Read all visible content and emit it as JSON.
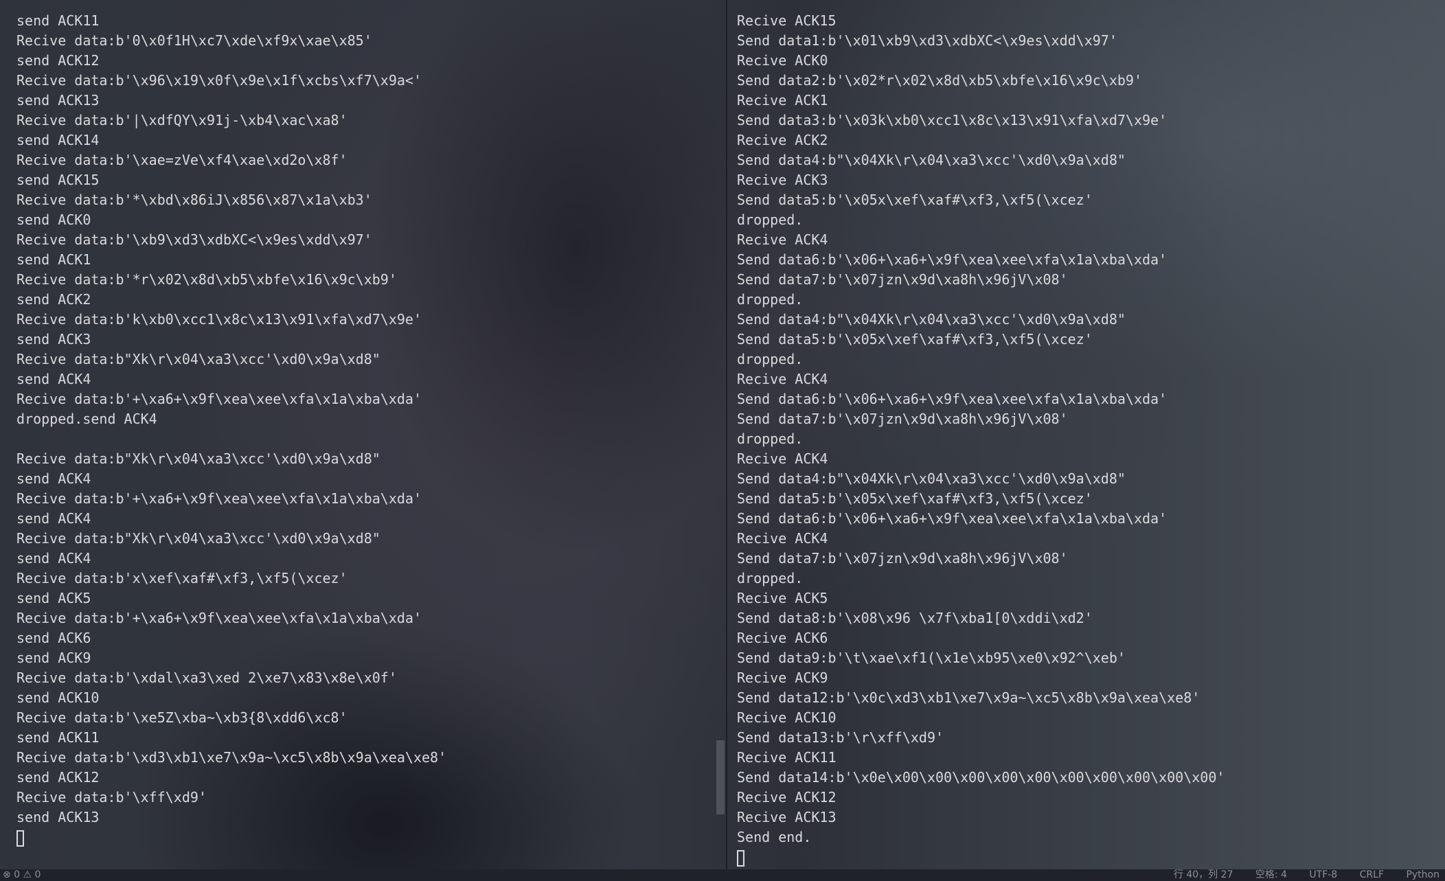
{
  "terminal_left": {
    "lines": [
      "send ACK11",
      "Recive data:b'0\\x0f1H\\xc7\\xde\\xf9x\\xae\\x85'",
      "send ACK12",
      "Recive data:b'\\x96\\x19\\x0f\\x9e\\x1f\\xcbs\\xf7\\x9a<'",
      "send ACK13",
      "Recive data:b'|\\xdfQY\\x91j-\\xb4\\xac\\xa8'",
      "send ACK14",
      "Recive data:b'\\xae=zVe\\xf4\\xae\\xd2o\\x8f'",
      "send ACK15",
      "Recive data:b'*\\xbd\\x86iJ\\x856\\x87\\x1a\\xb3'",
      "send ACK0",
      "Recive data:b'\\xb9\\xd3\\xdbXC<\\x9es\\xdd\\x97'",
      "send ACK1",
      "Recive data:b'*r\\x02\\x8d\\xb5\\xbfe\\x16\\x9c\\xb9'",
      "send ACK2",
      "Recive data:b'k\\xb0\\xcc1\\x8c\\x13\\x91\\xfa\\xd7\\x9e'",
      "send ACK3",
      "Recive data:b\"Xk\\r\\x04\\xa3\\xcc'\\xd0\\x9a\\xd8\"",
      "send ACK4",
      "Recive data:b'+\\xa6+\\x9f\\xea\\xee\\xfa\\x1a\\xba\\xda'",
      "dropped.send ACK4",
      "",
      "Recive data:b\"Xk\\r\\x04\\xa3\\xcc'\\xd0\\x9a\\xd8\"",
      "send ACK4",
      "Recive data:b'+\\xa6+\\x9f\\xea\\xee\\xfa\\x1a\\xba\\xda'",
      "send ACK4",
      "Recive data:b\"Xk\\r\\x04\\xa3\\xcc'\\xd0\\x9a\\xd8\"",
      "send ACK4",
      "Recive data:b'x\\xef\\xaf#\\xf3,\\xf5(\\xcez'",
      "send ACK5",
      "Recive data:b'+\\xa6+\\x9f\\xea\\xee\\xfa\\x1a\\xba\\xda'",
      "send ACK6",
      "send ACK9",
      "Recive data:b'\\xdal\\xa3\\xed 2\\xe7\\x83\\x8e\\x0f'",
      "send ACK10",
      "Recive data:b'\\xe5Z\\xba~\\xb3{8\\xdd6\\xc8'",
      "send ACK11",
      "Recive data:b'\\xd3\\xb1\\xe7\\x9a~\\xc5\\x8b\\x9a\\xea\\xe8'",
      "send ACK12",
      "Recive data:b'\\xff\\xd9'",
      "send ACK13"
    ]
  },
  "terminal_right": {
    "lines": [
      "Recive ACK15",
      "Send data1:b'\\x01\\xb9\\xd3\\xdbXC<\\x9es\\xdd\\x97'",
      "Recive ACK0",
      "Send data2:b'\\x02*r\\x02\\x8d\\xb5\\xbfe\\x16\\x9c\\xb9'",
      "Recive ACK1",
      "Send data3:b'\\x03k\\xb0\\xcc1\\x8c\\x13\\x91\\xfa\\xd7\\x9e'",
      "Recive ACK2",
      "Send data4:b\"\\x04Xk\\r\\x04\\xa3\\xcc'\\xd0\\x9a\\xd8\"",
      "Recive ACK3",
      "Send data5:b'\\x05x\\xef\\xaf#\\xf3,\\xf5(\\xcez'",
      "dropped.",
      "Recive ACK4",
      "Send data6:b'\\x06+\\xa6+\\x9f\\xea\\xee\\xfa\\x1a\\xba\\xda'",
      "Send data7:b'\\x07jzn\\x9d\\xa8h\\x96jV\\x08'",
      "dropped.",
      "Send data4:b\"\\x04Xk\\r\\x04\\xa3\\xcc'\\xd0\\x9a\\xd8\"",
      "Send data5:b'\\x05x\\xef\\xaf#\\xf3,\\xf5(\\xcez'",
      "dropped.",
      "Recive ACK4",
      "Send data6:b'\\x06+\\xa6+\\x9f\\xea\\xee\\xfa\\x1a\\xba\\xda'",
      "Send data7:b'\\x07jzn\\x9d\\xa8h\\x96jV\\x08'",
      "dropped.",
      "Recive ACK4",
      "Send data4:b\"\\x04Xk\\r\\x04\\xa3\\xcc'\\xd0\\x9a\\xd8\"",
      "Send data5:b'\\x05x\\xef\\xaf#\\xf3,\\xf5(\\xcez'",
      "Send data6:b'\\x06+\\xa6+\\x9f\\xea\\xee\\xfa\\x1a\\xba\\xda'",
      "Recive ACK4",
      "Send data7:b'\\x07jzn\\x9d\\xa8h\\x96jV\\x08'",
      "dropped.",
      "Recive ACK5",
      "Send data8:b'\\x08\\x96 \\x7f\\xba1[0\\xddi\\xd2'",
      "Recive ACK6",
      "Send data9:b'\\t\\xae\\xf1(\\x1e\\xb95\\xe0\\x92^\\xeb'",
      "Recive ACK9",
      "Send data12:b'\\x0c\\xd3\\xb1\\xe7\\x9a~\\xc5\\x8b\\x9a\\xea\\xe8'",
      "Recive ACK10",
      "Send data13:b'\\r\\xff\\xd9'",
      "Recive ACK11",
      "Send data14:b'\\x0e\\x00\\x00\\x00\\x00\\x00\\x00\\x00\\x00\\x00\\x00'",
      "Recive ACK12",
      "Recive ACK13",
      "Send end."
    ]
  },
  "status_bar": {
    "left": "⊗ 0 ⚠ 0",
    "ln_col": "行 40，列 27",
    "spaces": "空格: 4",
    "encoding": "UTF-8",
    "eol": "CRLF",
    "language": "Python"
  },
  "colors": {
    "text": "#d9dadc",
    "status_text": "#8c9097"
  }
}
